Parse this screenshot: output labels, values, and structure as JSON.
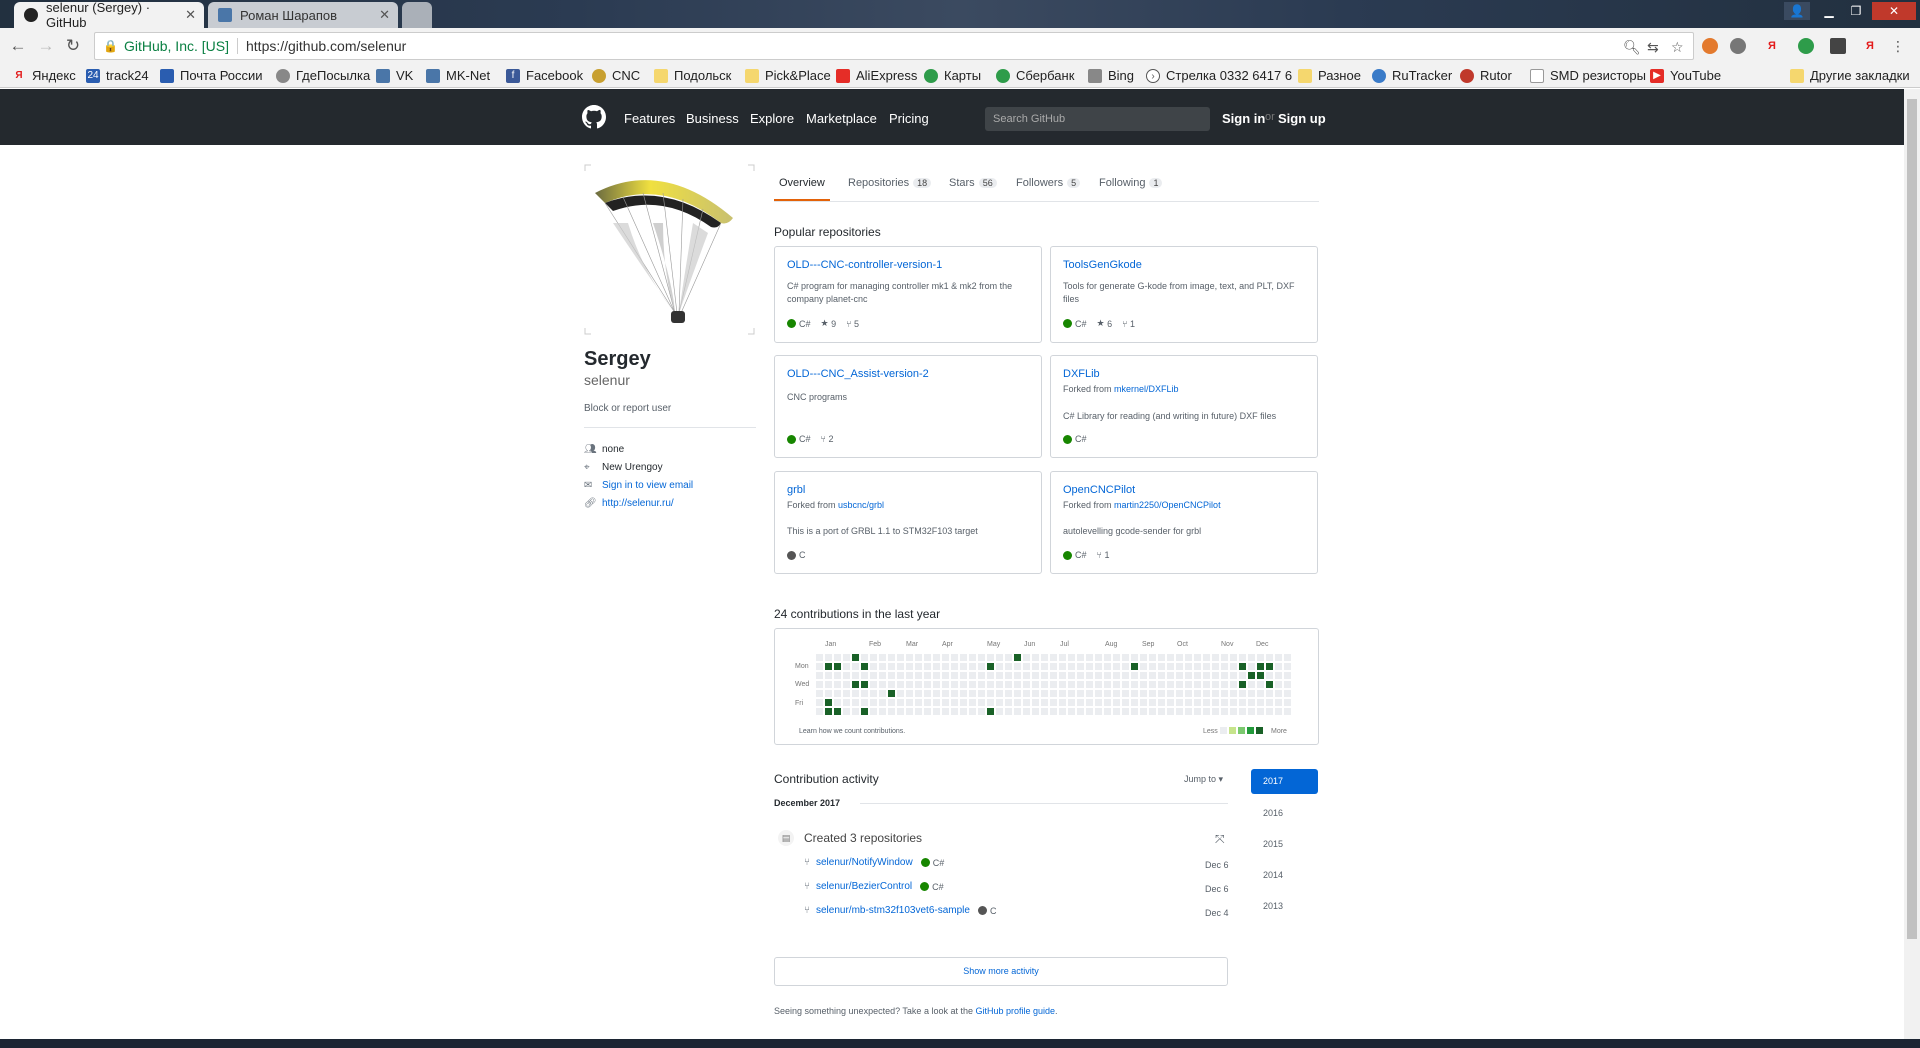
{
  "browser": {
    "tabs": [
      {
        "title": "selenur (Sergey) · GitHub",
        "active": true
      },
      {
        "title": "Роман Шарапов",
        "active": false
      }
    ],
    "security_label": "GitHub, Inc. [US]",
    "url": "https://github.com/selenur",
    "bookmarks": [
      {
        "label": "Яндекс",
        "icon": "yandex-icon",
        "color": "#e31b1b"
      },
      {
        "label": "track24",
        "icon": "track24-icon",
        "color": "#2a5db0"
      },
      {
        "label": "Почта России",
        "icon": "pochta-icon",
        "color": "#2a5db0"
      },
      {
        "label": "ГдеПосылка",
        "icon": "gdeposylka-icon",
        "color": "#888888"
      },
      {
        "label": "VK",
        "icon": "vk-icon",
        "color": "#4a76a8"
      },
      {
        "label": "MK-Net",
        "icon": "vk-icon",
        "color": "#4a76a8"
      },
      {
        "label": "Facebook",
        "icon": "facebook-icon",
        "color": "#3b5998"
      },
      {
        "label": "CNC",
        "icon": "cnc-icon",
        "color": "#c8a030"
      },
      {
        "label": "Подольск",
        "icon": "folder-icon",
        "color": "#f5d76e"
      },
      {
        "label": "Pick&Place",
        "icon": "folder-icon",
        "color": "#f5d76e"
      },
      {
        "label": "AliExpress",
        "icon": "aliexpress-icon",
        "color": "#e52d27"
      },
      {
        "label": "Карты",
        "icon": "maps-icon",
        "color": "#2e9c4a"
      },
      {
        "label": "Сбербанк",
        "icon": "sberbank-icon",
        "color": "#2e9c4a"
      },
      {
        "label": "Bing",
        "icon": "bing-icon",
        "color": "#888888"
      },
      {
        "label": "Стрелка 0332 6417 6",
        "icon": "strelka-icon",
        "color": "#555555"
      },
      {
        "label": "Разное",
        "icon": "folder-icon",
        "color": "#f5d76e"
      },
      {
        "label": "RuTracker",
        "icon": "rutracker-icon",
        "color": "#3a7bc8"
      },
      {
        "label": "Rutor",
        "icon": "rutor-icon",
        "color": "#c0392b"
      },
      {
        "label": "SMD резисторы",
        "icon": "page-icon",
        "color": "#999999"
      },
      {
        "label": "YouTube",
        "icon": "youtube-icon",
        "color": "#e52d27"
      }
    ],
    "other_bookmarks": "Другие закладки"
  },
  "github": {
    "nav": [
      "Features",
      "Business",
      "Explore",
      "Marketplace",
      "Pricing"
    ],
    "search_placeholder": "Search GitHub",
    "sign_in": "Sign in",
    "or": "or",
    "sign_up": "Sign up"
  },
  "profile": {
    "name": "Sergey",
    "login": "selenur",
    "block_report": "Block or report user",
    "company": "none",
    "location": "New Urengoy",
    "email": "Sign in to view email",
    "website": "http://selenur.ru/"
  },
  "tabs": [
    {
      "label": "Overview",
      "count": null,
      "selected": true
    },
    {
      "label": "Repositories",
      "count": "18"
    },
    {
      "label": "Stars",
      "count": "56"
    },
    {
      "label": "Followers",
      "count": "5"
    },
    {
      "label": "Following",
      "count": "1"
    }
  ],
  "popular_title": "Popular repositories",
  "repos": [
    {
      "name": "OLD---CNC-controller-version-1",
      "forked_from": null,
      "desc": "C# program for managing controller mk1 & mk2 from the company planet-cnc",
      "lang": "C#",
      "lang_color": "#178600",
      "stars": "9",
      "forks": "5"
    },
    {
      "name": "ToolsGenGkode",
      "forked_from": null,
      "desc": "Tools for generate G-kode from image, text, and PLT, DXF files",
      "lang": "C#",
      "lang_color": "#178600",
      "stars": "6",
      "forks": "1"
    },
    {
      "name": "OLD---CNC_Assist-version-2",
      "forked_from": null,
      "desc": "CNC programs",
      "lang": "C#",
      "lang_color": "#178600",
      "stars": null,
      "forks": "2"
    },
    {
      "name": "DXFLib",
      "forked_prefix": "Forked from ",
      "forked_from": "mkernel/DXFLib",
      "desc": "C# Library for reading (and writing in future) DXF files",
      "lang": "C#",
      "lang_color": "#178600",
      "stars": null,
      "forks": null
    },
    {
      "name": "grbl",
      "forked_prefix": "Forked from ",
      "forked_from": "usbcnc/grbl",
      "desc": "This is a port of GRBL 1.1 to STM32F103 target",
      "lang": "C",
      "lang_color": "#555555",
      "stars": null,
      "forks": null
    },
    {
      "name": "OpenCNCPilot",
      "forked_prefix": "Forked from ",
      "forked_from": "martin2250/OpenCNCPilot",
      "desc": "autolevelling gcode-sender for grbl",
      "lang": "C#",
      "lang_color": "#178600",
      "stars": null,
      "forks": "1"
    }
  ],
  "contrib_title": "24 contributions in the last year",
  "graph": {
    "months": [
      "Jan",
      "Feb",
      "Mar",
      "Apr",
      "May",
      "Jun",
      "Jul",
      "Aug",
      "Sep",
      "Oct",
      "Nov",
      "Dec"
    ],
    "weekdays": [
      "Mon",
      "Wed",
      "Fri"
    ],
    "learn_link": "Learn how we count contributions.",
    "less": "Less",
    "more": "More",
    "colors": [
      "#ebedf0",
      "#c6e48b",
      "#7bc96f",
      "#239a3b",
      "#196127"
    ],
    "active_cells": [
      [
        1,
        1
      ],
      [
        1,
        5
      ],
      [
        1,
        6
      ],
      [
        2,
        1
      ],
      [
        2,
        6
      ],
      [
        4,
        0
      ],
      [
        4,
        3
      ],
      [
        5,
        1
      ],
      [
        5,
        3
      ],
      [
        5,
        6
      ],
      [
        8,
        4
      ],
      [
        19,
        1
      ],
      [
        19,
        6
      ],
      [
        22,
        0
      ],
      [
        35,
        1
      ],
      [
        47,
        1
      ],
      [
        47,
        3
      ],
      [
        48,
        2
      ],
      [
        49,
        1
      ],
      [
        49,
        2
      ],
      [
        50,
        1
      ],
      [
        50,
        3
      ]
    ]
  },
  "activity": {
    "title": "Contribution activity",
    "jump_to": "Jump to ▾",
    "month": "December 2017",
    "created": "Created 3 repositories",
    "items": [
      {
        "repo": "selenur/NotifyWindow",
        "lang": "C#",
        "lang_color": "#178600",
        "date": "Dec 6"
      },
      {
        "repo": "selenur/BezierControl",
        "lang": "C#",
        "lang_color": "#178600",
        "date": "Dec 6"
      },
      {
        "repo": "selenur/mb-stm32f103vet6-sample",
        "lang": "C",
        "lang_color": "#555555",
        "date": "Dec 4"
      }
    ],
    "years": [
      "2017",
      "2016",
      "2015",
      "2014",
      "2013"
    ],
    "show_more": "Show more activity",
    "footer_prefix": "Seeing something unexpected? Take a look at the ",
    "footer_link": "GitHub profile guide",
    "footer_suffix": "."
  }
}
